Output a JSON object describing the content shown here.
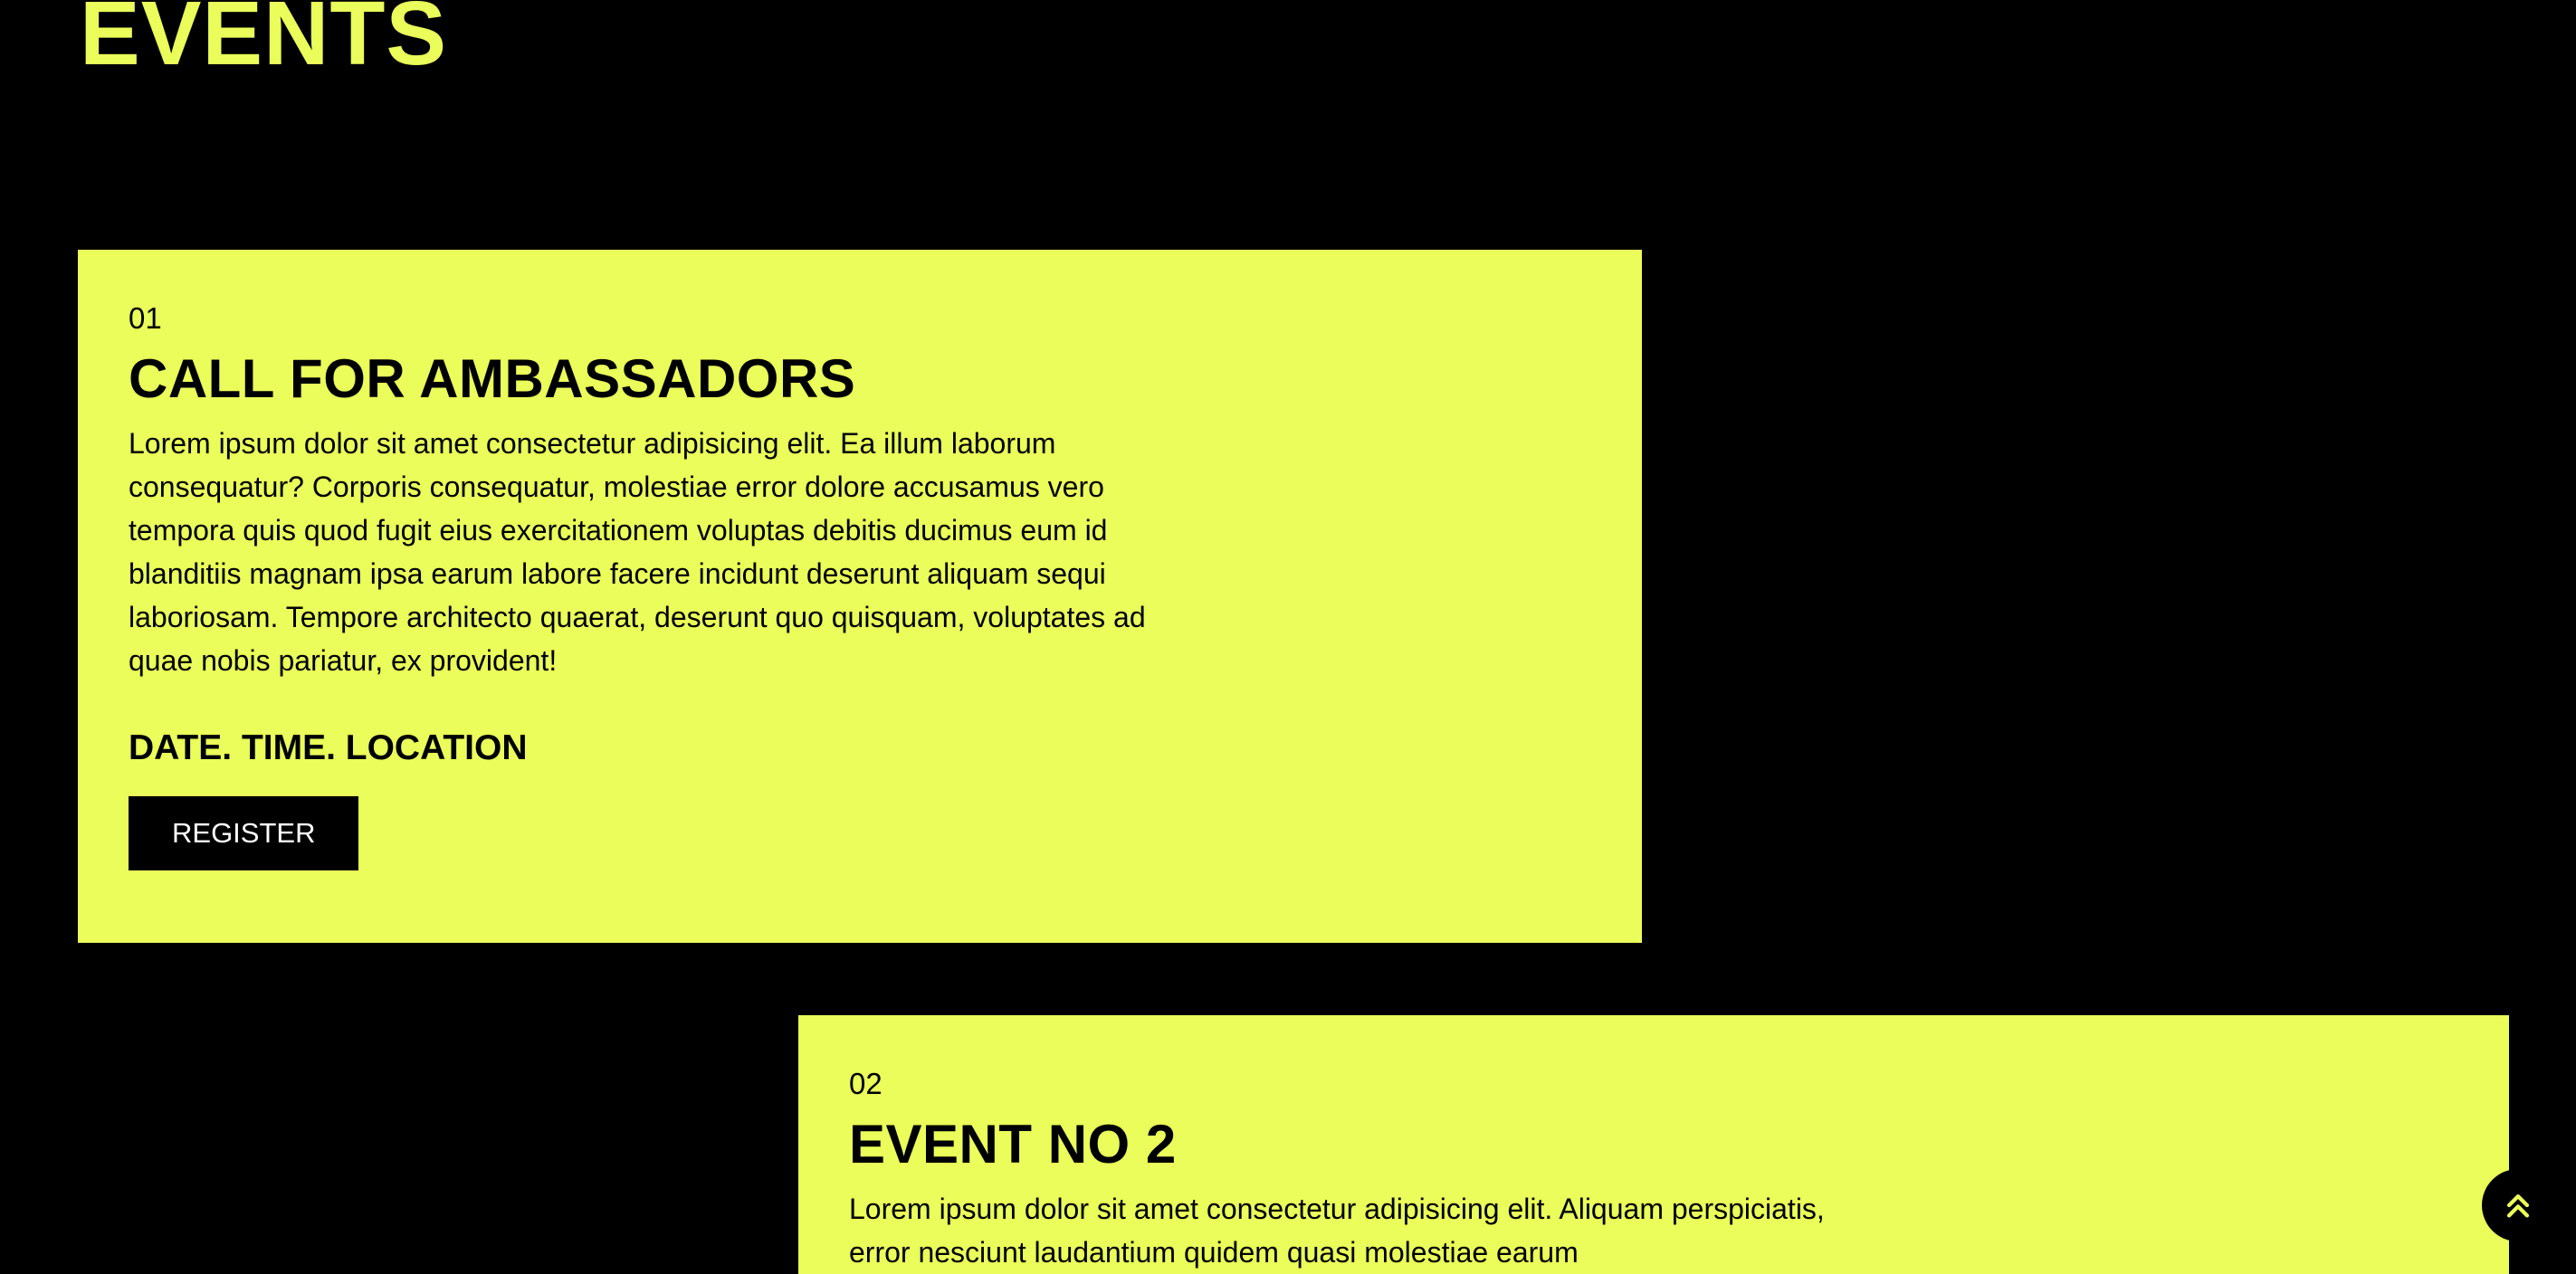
{
  "page": {
    "title": "EVENTS"
  },
  "events": [
    {
      "number": "01",
      "title": "CALL FOR AMBASSADORS",
      "description": "Lorem ipsum dolor sit amet consectetur adipisicing elit. Ea illum laborum consequatur? Corporis consequatur, molestiae error dolore accusamus vero tempora quis quod fugit eius exercitationem voluptas debitis ducimus eum id blanditiis magnam ipsa earum labore facere incidunt deserunt aliquam sequi laboriosam. Tempore architecto quaerat, deserunt quo quisquam, voluptates ad quae nobis pariatur, ex provident!",
      "meta": "DATE. TIME. LOCATION",
      "button_label": "REGISTER"
    },
    {
      "number": "02",
      "title": "EVENT NO 2",
      "description": "Lorem ipsum dolor sit amet consectetur adipisicing elit. Aliquam perspiciatis, error nesciunt laudantium quidem quasi molestiae earum"
    }
  ],
  "scroll_top": {
    "icon": "double-chevron-up-icon"
  },
  "colors": {
    "background": "#000000",
    "accent": "#eafd5a",
    "text_dark": "#000000",
    "button_text": "#ffffff"
  }
}
